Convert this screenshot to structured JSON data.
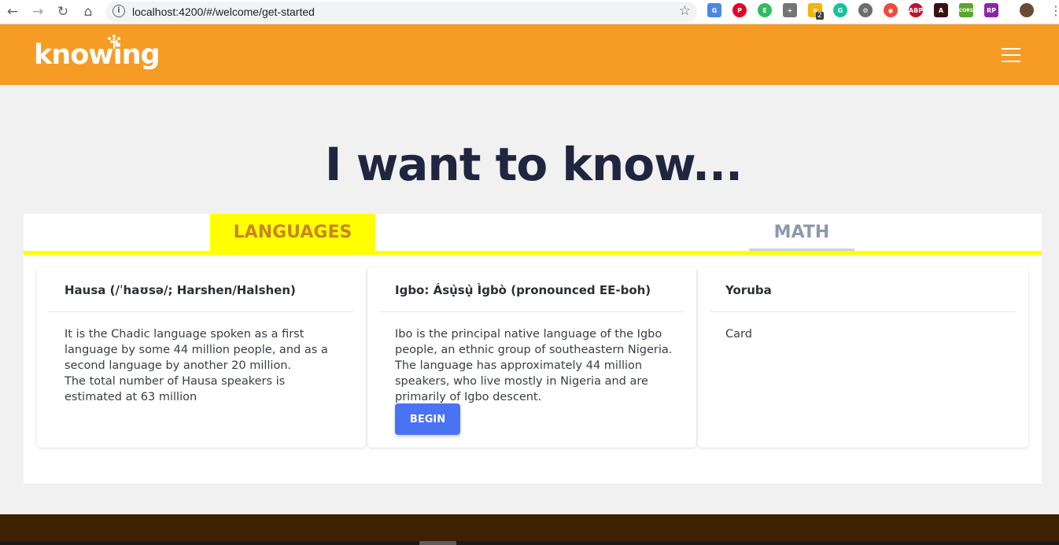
{
  "browser": {
    "url": "localhost:4200/#/welcome/get-started",
    "back_icon": "←",
    "forward_icon": "→",
    "reload_icon": "↻",
    "home_icon": "⌂",
    "info_icon": "i",
    "star_icon": "☆",
    "menu_icon": "⋮",
    "extensions": [
      {
        "name": "google-translate",
        "label": "G",
        "color": "#4a86e8"
      },
      {
        "name": "pinterest",
        "label": "P",
        "color": "#e60023"
      },
      {
        "name": "evernote",
        "label": "E",
        "color": "#2dbe60"
      },
      {
        "name": "comment",
        "label": "+",
        "color": "#757575"
      },
      {
        "name": "notes",
        "label": "≡",
        "color": "#f4b400"
      },
      {
        "name": "grammarly",
        "label": "G",
        "color": "#15c39a"
      },
      {
        "name": "settings",
        "label": "⚙",
        "color": "#6d6d6d"
      },
      {
        "name": "screen-record",
        "label": "◉",
        "color": "#ee4b3a"
      },
      {
        "name": "adblock",
        "label": "ABP",
        "color": "#c70d2c"
      },
      {
        "name": "pdf",
        "label": "A",
        "color": "#3a1212"
      },
      {
        "name": "cors",
        "label": "CORS",
        "color": "#59a62b"
      },
      {
        "name": "rp",
        "label": "RP",
        "color": "#8e24aa"
      }
    ],
    "notes_badge": "2"
  },
  "app": {
    "logo_text": "knowing",
    "headline": "I want to know..."
  },
  "tabs": [
    {
      "label": "LANGUAGES",
      "active": true
    },
    {
      "label": "MATH",
      "active": false
    }
  ],
  "cards": [
    {
      "title": "Hausa (/ˈhaʊsə/; Harshen/Halshen)",
      "body_lines": [
        "It is the Chadic language spoken as a first language by some 44 million people, and as a second language by another 20 million.",
        "The total number of Hausa speakers is estimated at 63 million"
      ]
    },
    {
      "title": "Igbo: Ásụ̀sụ̀ Ìgbò (pronounced EE-boh)",
      "body_lines": [
        "Ibo is the principal native language of the Igbo people, an ethnic group of southeastern Nigeria. The language has approximately 44 million speakers, who live mostly in Nigeria and are primarily of Igbo descent."
      ],
      "button_label": "BEGIN"
    },
    {
      "title": "Yoruba",
      "body_lines": [
        "Card"
      ]
    }
  ],
  "colors": {
    "header": "#f69c24",
    "active_tab": "#ffff00",
    "active_tab_text": "#c8861b",
    "inactive_tab_text": "#8c99ab",
    "headline": "#1e2640",
    "button": "#4a73f3",
    "footer": "#3d2100"
  }
}
